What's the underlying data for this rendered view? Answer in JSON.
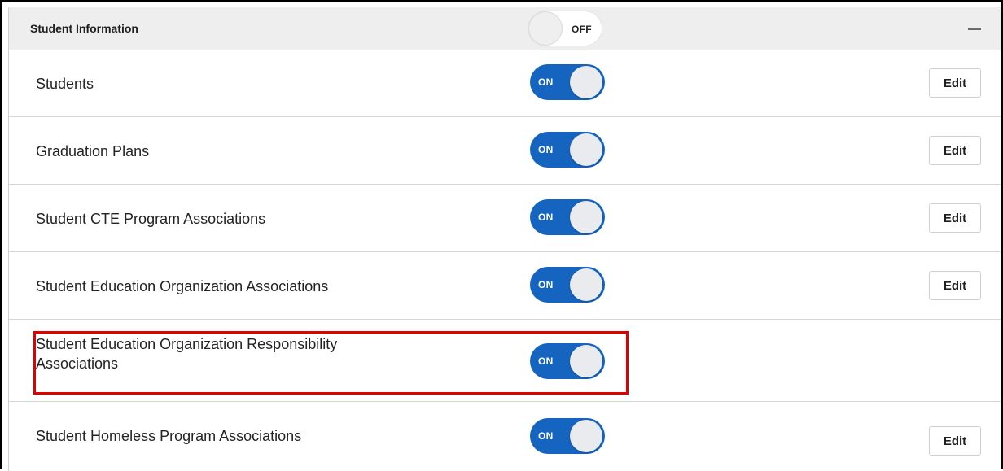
{
  "section": {
    "title": "Student Information",
    "master_toggle": {
      "state": "OFF"
    }
  },
  "rows": [
    {
      "label": "Students",
      "toggle": "ON",
      "edit_label": "Edit"
    },
    {
      "label": "Graduation Plans",
      "toggle": "ON",
      "edit_label": "Edit"
    },
    {
      "label": "Student CTE Program Associations",
      "toggle": "ON",
      "edit_label": "Edit"
    },
    {
      "label": "Student Education Organization Associations",
      "toggle": "ON",
      "edit_label": "Edit"
    },
    {
      "label": "Student Education Organization Responsibility Associations",
      "toggle": "ON",
      "edit_label": null,
      "highlighted": true
    },
    {
      "label": "Student Homeless Program Associations",
      "toggle": "ON",
      "edit_label": "Edit"
    }
  ],
  "colors": {
    "toggle_on": "#1565c0",
    "header_bg": "#eeeeee",
    "highlight": "#e00000"
  },
  "icons": {
    "collapse": "minus-icon"
  }
}
